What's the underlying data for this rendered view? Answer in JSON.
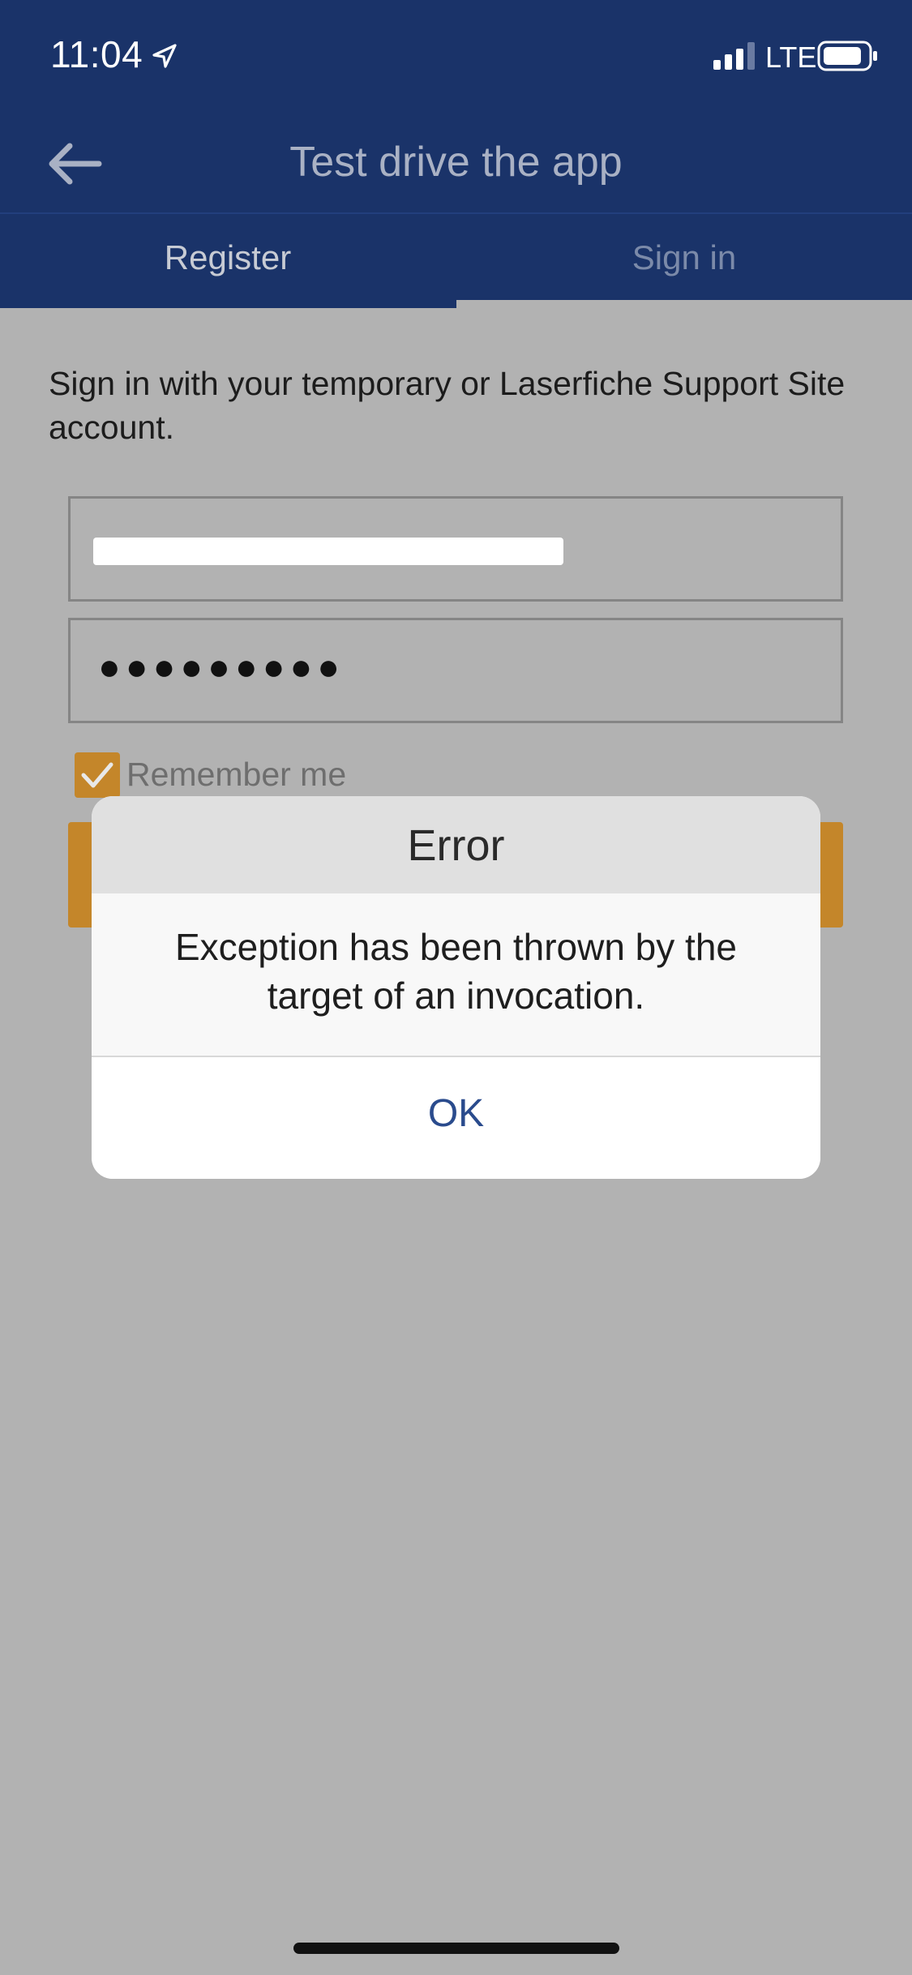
{
  "status_bar": {
    "time": "11:04",
    "network": "LTE",
    "icons": [
      "location-arrow-icon",
      "signal-icon",
      "battery-icon"
    ]
  },
  "nav": {
    "back_icon": "arrow-left-icon",
    "title": "Test drive the app"
  },
  "tabs": [
    {
      "label": "Register",
      "active": false
    },
    {
      "label": "Sign in",
      "active": true
    }
  ],
  "form": {
    "intro": "Sign in with your temporary or Laserfiche Support Site account.",
    "password_mask": "●●●●●●●●●",
    "remember_label": "Remember me",
    "remember_checked": true
  },
  "dialog": {
    "title": "Error",
    "message": "Exception has been thrown by the target of an invocation.",
    "ok_label": "OK"
  },
  "colors": {
    "header": "#1a3369",
    "accent": "#c4862a",
    "overlay": "#b2b2b2",
    "link": "#2a4b8d"
  }
}
